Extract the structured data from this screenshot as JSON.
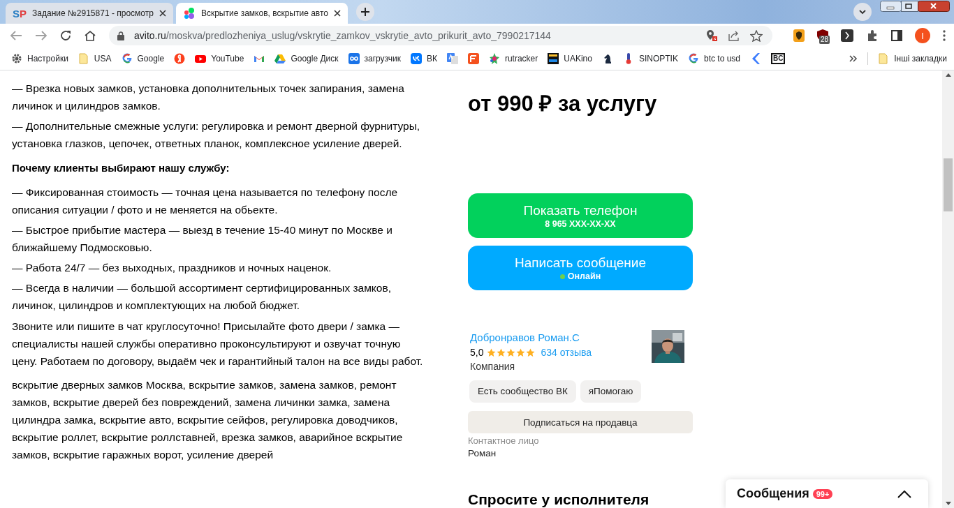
{
  "browser": {
    "tabs": [
      {
        "title": "Задание №2915871 - просмотр",
        "selected": false,
        "kind": "sp",
        "favicon": [
          "S",
          "P"
        ]
      },
      {
        "title": "Вскрытие замков, вскрытие авто",
        "selected": true,
        "kind": "avito"
      }
    ],
    "address": {
      "host": "avito.ru",
      "path": "/moskva/predlozheniya_uslug/vskrytie_zamkov_vskrytie_avto_prikurit_avto_7990217144"
    },
    "extension_badge": "28",
    "profile_initial": "I",
    "bookmarks": [
      {
        "kind": "gear",
        "label": "Настройки"
      },
      {
        "kind": "folder",
        "label": "USA"
      },
      {
        "kind": "google",
        "label": "Google"
      },
      {
        "kind": "ya"
      },
      {
        "kind": "youtube",
        "label": "YouTube"
      },
      {
        "kind": "gmail"
      },
      {
        "kind": "drive",
        "label": "Google Диск"
      },
      {
        "kind": "infinity",
        "label": "загрузчик"
      },
      {
        "kind": "vk",
        "label": "ВК"
      },
      {
        "kind": "translate"
      },
      {
        "kind": "orange"
      },
      {
        "kind": "star",
        "label": "rutracker"
      },
      {
        "kind": "film",
        "label": "UAKino"
      },
      {
        "kind": "knight"
      },
      {
        "kind": "thermo",
        "label": "SINOPTIK"
      },
      {
        "kind": "google",
        "label": "btc to usd"
      },
      {
        "kind": "arrow"
      },
      {
        "kind": "bc",
        "label": "BC"
      }
    ],
    "other_bookmarks": "Інші закладки"
  },
  "description": [
    {
      "kind": "text",
      "text": "— Врезка новых замков, установка дополнительных точек запирания, замена личинок и цилиндров замков."
    },
    {
      "kind": "text",
      "text": "— Дополнительные смежные услуги: регулировка и ремонт дверной фурнитуры, установка глазков, цепочек, ответных планок, комплексное усиление дверей."
    },
    {
      "kind": "heading",
      "text": "Почему клиенты выбирают нашу службу:"
    },
    {
      "kind": "text",
      "text": "— Фиксированная стоимость — точная цена называется по телефону после описания ситуации / фото и не меняется на обьекте."
    },
    {
      "kind": "text",
      "text": "— Быстрое прибытие мастера — выезд в течение 15-40 минут по Москве и ближайшему Подмосковью."
    },
    {
      "kind": "text",
      "text": "— Работа 24/7 — без выходных, праздников и ночных наценок."
    },
    {
      "kind": "text",
      "text": "— Всегда в наличии — большой ассортимент сертифицированных замков, личинок, цилиндров и комплектующих на любой бюджет."
    },
    {
      "kind": "block",
      "text": "Звоните или пишите в чат круглосуточно! Присылайте фото двери / замка — специалисты нашей службы оперативно проконсультируют и озвучат точную цену. Работаем по договору, выдаём чек и гарантийный талон на все виды работ."
    },
    {
      "kind": "block",
      "text": "вскрытие дверных замков Москва, вскрытие замков, замена замков, ремонт замков, вскрытие дверей без повреждений, замена личинки замка, замена цилиндра замка, вскрытие авто, вскрытие сейфов, регулировка доводчиков, вскрытие роллет, вскрытие роллставней, врезка замков, аварийное вскрытие замков, вскрытие гаражных ворот, усиление дверей"
    }
  ],
  "price": "от 990 ₽ за услугу",
  "phone_button": {
    "label": "Показать телефон",
    "number": "8 965 XXX-XX-XX"
  },
  "message_button": {
    "label": "Написать сообщение",
    "status": "Онлайн",
    "online": true
  },
  "seller": {
    "name": "Добронравов Роман.С",
    "rating": "5,0",
    "stars": 5,
    "reviews": "634 отзыва",
    "type": "Компания",
    "tags": [
      "Есть сообщество ВК",
      "яПомогаю"
    ],
    "subscribe": "Подписаться на продавца",
    "contact_label": "Контактное лицо",
    "contact_name": "Роман"
  },
  "ask_heading": "Спросите у исполнителя",
  "messages_popup": {
    "label": "Сообщения",
    "badge": "99+",
    "expanded": false
  }
}
